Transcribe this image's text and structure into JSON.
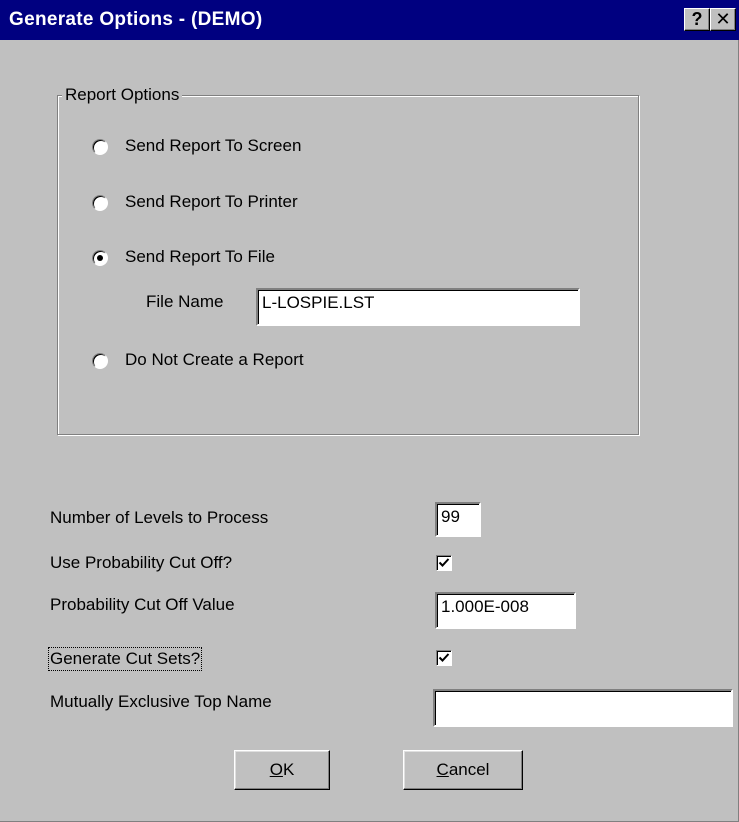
{
  "window": {
    "title": "Generate Options  -  (DEMO)",
    "help_button": "?",
    "close_button": "✕"
  },
  "report_options": {
    "legend": "Report Options",
    "radios": [
      {
        "label": "Send Report To Screen",
        "selected": false
      },
      {
        "label": "Send Report To Printer",
        "selected": false
      },
      {
        "label": "Send Report To File",
        "selected": true
      },
      {
        "label": "Do Not Create a Report",
        "selected": false
      }
    ],
    "file_name_label": "File Name",
    "file_name_value": "L-LOSPIE.LST"
  },
  "settings": {
    "levels_label": "Number of Levels to Process",
    "levels_value": "99",
    "use_cutoff_label": "Use Probability Cut Off?",
    "use_cutoff_checked": true,
    "cutoff_value_label": "Probability Cut Off Value",
    "cutoff_value": "1.000E-008",
    "generate_cut_sets_label": "Generate Cut Sets?",
    "generate_cut_sets_checked": true,
    "top_name_label": "Mutually Exclusive Top Name",
    "top_name_value": ""
  },
  "buttons": {
    "ok_mnemonic": "O",
    "ok_rest": "K",
    "cancel_mnemonic": "C",
    "cancel_rest": "ancel"
  }
}
